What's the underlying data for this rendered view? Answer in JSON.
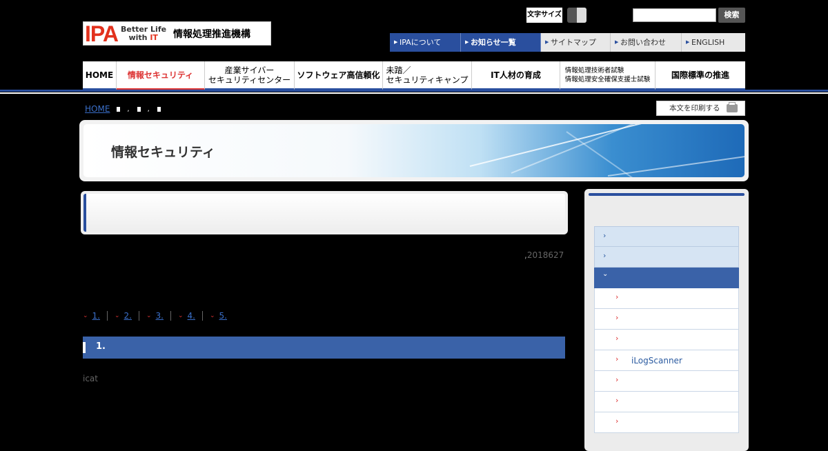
{
  "logo": {
    "mark": "IPA",
    "tagline_1": "Better Life",
    "tagline_2_prefix": "with ",
    "tagline_2_it": "IT",
    "org_name": "情報処理推進機構"
  },
  "fontsize": {
    "label": "文字サイズ"
  },
  "search": {
    "placeholder": "",
    "button": "検索"
  },
  "util_nav": [
    {
      "label": "IPAについて",
      "style": "blue"
    },
    {
      "label": "お知らせ一覧",
      "style": "blue"
    },
    {
      "label": "サイトマップ",
      "style": "grey"
    },
    {
      "label": "お問い合わせ",
      "style": "grey"
    },
    {
      "label": "ENGLISH",
      "style": "grey"
    }
  ],
  "global_nav": [
    {
      "line1": "HOME",
      "line2": ""
    },
    {
      "line1": "情報セキュリティ",
      "line2": ""
    },
    {
      "line1": "産業サイバー",
      "line2": "セキュリティセンター"
    },
    {
      "line1": "ソフトウェア高信頼化",
      "line2": ""
    },
    {
      "line1": "未踏／",
      "line2": "セキュリティキャンプ"
    },
    {
      "line1": "IT人材の育成",
      "line2": ""
    },
    {
      "line1": "情報処理技術者試験",
      "line2": "情報処理安全確保支援士試験"
    },
    {
      "line1": "国際標準の推進",
      "line2": ""
    }
  ],
  "breadcrumb": {
    "home": "HOME"
  },
  "print": {
    "label": "本文を印刷する"
  },
  "banner": {
    "title": "情報セキュリティ"
  },
  "article": {
    "date": "2018627",
    "date_mark": ","
  },
  "toc": [
    "1.",
    "2.",
    "3.",
    "4.",
    "5."
  ],
  "section": {
    "heading": "1.",
    "body": "icat"
  },
  "sidebar": {
    "items": [
      {
        "level": 1,
        "label": ""
      },
      {
        "level": 1,
        "label": ""
      },
      {
        "level": "open",
        "label": ""
      },
      {
        "level": 2,
        "label": ""
      },
      {
        "level": 2,
        "label": ""
      },
      {
        "level": 2,
        "label": ""
      },
      {
        "level": 2,
        "label": "iLogScanner"
      },
      {
        "level": 2,
        "label": ""
      },
      {
        "level": 2,
        "label": ""
      },
      {
        "level": 2,
        "label": ""
      }
    ]
  },
  "colors": {
    "brand_blue": "#2a4f9e",
    "accent_red": "#d33",
    "logo_red": "#e2311d"
  }
}
